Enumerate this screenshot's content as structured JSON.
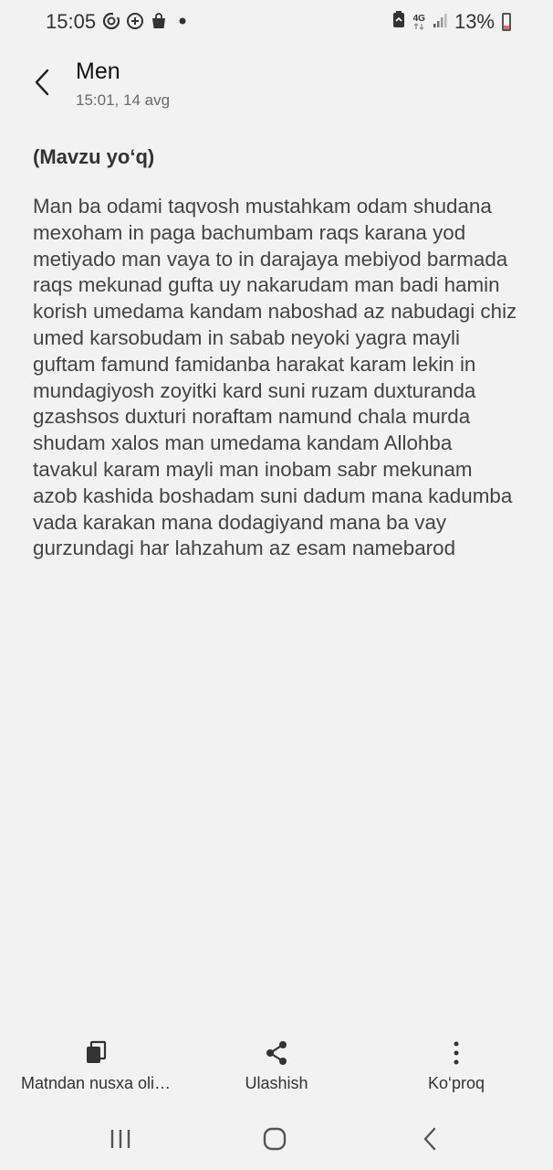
{
  "status_bar": {
    "time": "15:05",
    "network": "4G",
    "battery_percent": "13%",
    "battery_level": 0.13,
    "left_icons": [
      "sync-icon",
      "add-circle-icon",
      "shopping-bag-icon",
      "dot-icon"
    ],
    "right_icons": [
      "battery-saver-icon",
      "network-4g-icon",
      "signal-icon",
      "battery-icon"
    ]
  },
  "header": {
    "sender": "Men",
    "timestamp": "15:01, 14 avg"
  },
  "message": {
    "subject": "(Mavzu yo‘q)",
    "body": "Man ba odami taqvosh mustahkam odam shudana mexoham in paga bachumbam raqs karana yod metiyado man vaya to in darajaya mebiyod barmada raqs mekunad gufta uy nakarudam man badi hamin korish umedama kandam naboshad az nabudagi chiz umed karsobudam in sabab neyoki yagra mayli guftam famund famidanba harakat karam lekin in mundagiyosh zoyitki kard suni ruzam duxturanda gzashsos duxturi noraftam namund chala murda shudam xalos man umedama kandam Allohba tavakul karam mayli man inobam sabr mekunam azob kashida boshadam suni dadum mana kadumba vada karakan mana dodagiyand mana ba vay gurzundagi har lahzahum az esam namebarod"
  },
  "actions": {
    "copy_label": "Matndan nusxa oli…",
    "share_label": "Ulashish",
    "more_label": "Ko‘proq"
  },
  "nav": {
    "icons": [
      "recents-icon",
      "home-icon",
      "back-icon"
    ]
  }
}
